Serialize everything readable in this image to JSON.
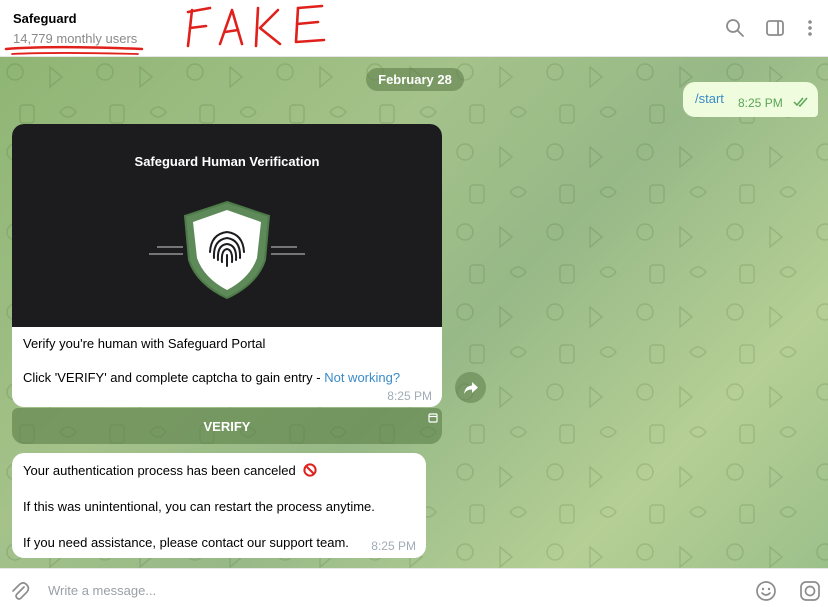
{
  "header": {
    "title": "Safeguard",
    "subtitle": "14,779 monthly users",
    "annotation": "FAKE",
    "icons": [
      "search-icon",
      "sidebar-toggle-icon",
      "more-vertical-icon"
    ]
  },
  "chat": {
    "date_label": "February 28",
    "outgoing": {
      "text": "/start",
      "time": "8:25 PM"
    },
    "card": {
      "image_title": "Safeguard Human Verification",
      "line1": "Verify you're human with Safeguard Portal",
      "line2_prefix": "Click 'VERIFY' and complete captcha to gain entry - ",
      "line2_link": "Not working?",
      "time": "8:25 PM",
      "button_label": "VERIFY"
    },
    "message2": {
      "line1": "Your authentication process has been canceled",
      "line2": "If this was unintentional, you can restart the process anytime.",
      "line3": "If you need assistance, please contact our support team.",
      "time": "8:25 PM"
    }
  },
  "composer": {
    "placeholder": "Write a message..."
  },
  "colors": {
    "accent": "#3a8bc7",
    "outgoing_bubble": "#effdde",
    "annotation_red": "#e0201b",
    "check_green": "#5aa458"
  }
}
